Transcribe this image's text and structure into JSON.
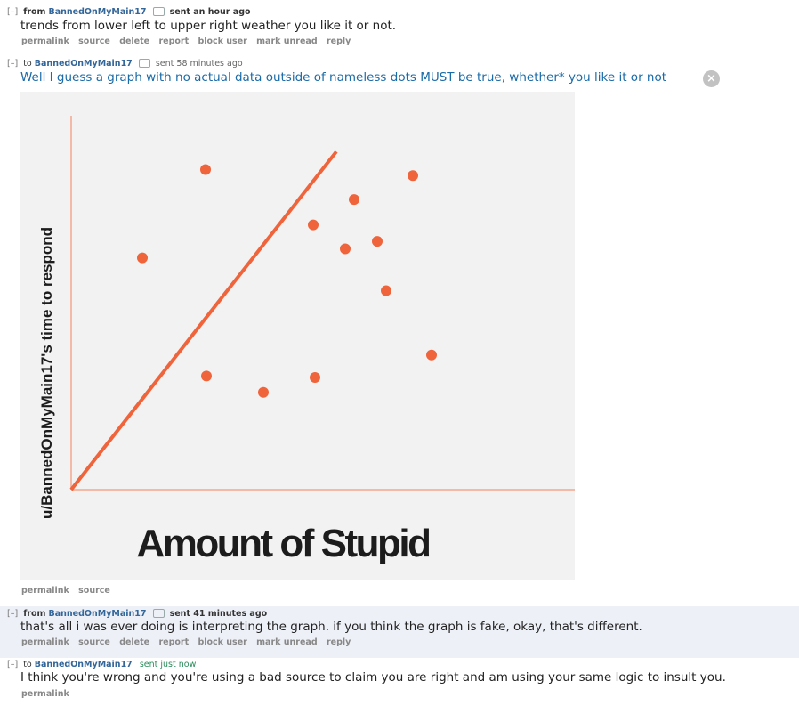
{
  "messages": [
    {
      "toggle": "[–]",
      "direction": "from",
      "author": "BannedOnMyMain17",
      "time": "sent an hour ago",
      "body": "trends from lower left to upper right weather you like it or not.",
      "actions": [
        "permalink",
        "source",
        "delete",
        "report",
        "block user",
        "mark unread",
        "reply"
      ]
    },
    {
      "toggle": "[–]",
      "direction": "to",
      "author": "BannedOnMyMain17",
      "time": "sent 58 minutes ago",
      "body": "Well I guess a graph with no actual data outside of nameless dots MUST be true, whether* you like it or not",
      "actions": [
        "permalink",
        "source"
      ]
    },
    {
      "toggle": "[–]",
      "direction": "from",
      "author": "BannedOnMyMain17",
      "time": "sent 41 minutes ago",
      "body": "that's all i was ever doing is interpreting the graph. if you think the graph is fake, okay, that's different.",
      "actions": [
        "permalink",
        "source",
        "delete",
        "report",
        "block user",
        "mark unread",
        "reply"
      ]
    },
    {
      "toggle": "[–]",
      "direction": "to",
      "author": "BannedOnMyMain17",
      "time": "sent just now",
      "body": "I think you're wrong and you're using a bad source to claim you are right and am using your same logic to insult you.",
      "actions": [
        "permalink"
      ]
    }
  ],
  "close_icon_glyph": "×",
  "colors": {
    "accent": "#f0643c",
    "author": "#369",
    "link_blue": "#1a6ba8"
  },
  "chart_data": {
    "type": "scatter",
    "title": "",
    "xlabel": "Amount of Stupid",
    "ylabel": "u/BannedOnMyMain17's time to respond",
    "xlim": [
      0,
      100
    ],
    "ylim": [
      0,
      100
    ],
    "grid": false,
    "points": [
      {
        "x": 16.0,
        "y": 62.0
      },
      {
        "x": 30.2,
        "y": 85.6
      },
      {
        "x": 30.4,
        "y": 30.4
      },
      {
        "x": 43.2,
        "y": 26.0
      },
      {
        "x": 54.4,
        "y": 70.8
      },
      {
        "x": 54.8,
        "y": 30.0
      },
      {
        "x": 61.6,
        "y": 64.4
      },
      {
        "x": 63.6,
        "y": 77.6
      },
      {
        "x": 68.8,
        "y": 66.4
      },
      {
        "x": 70.8,
        "y": 53.2
      },
      {
        "x": 76.8,
        "y": 84.0
      },
      {
        "x": 81.0,
        "y": 36.0
      }
    ],
    "trend_line": {
      "from": [
        0,
        0
      ],
      "to": [
        59.6,
        90.4
      ]
    }
  }
}
